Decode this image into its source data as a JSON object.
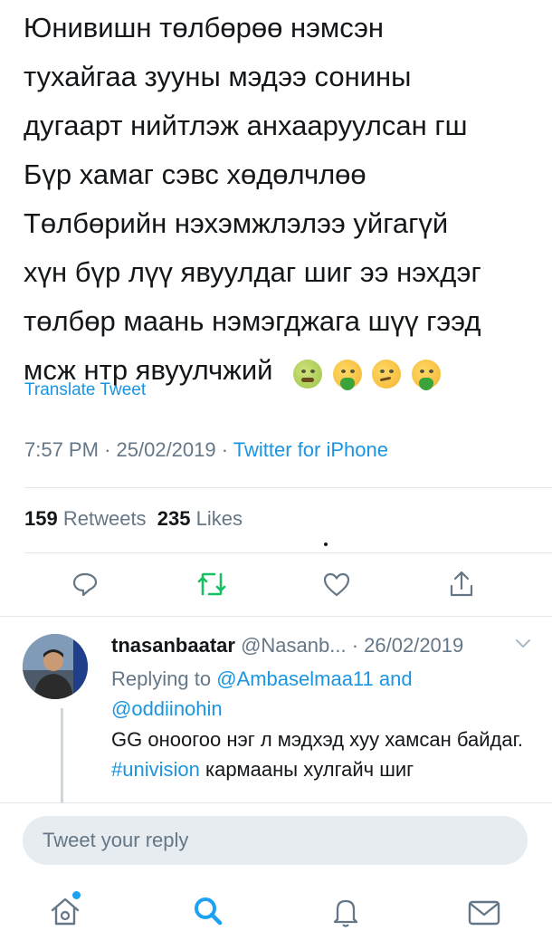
{
  "tweet": {
    "lines": [
      "Юнивишн төлбөрөө нэмсэн",
      "тухайгаа зууны мэдээ сонины",
      "дугаарт нийтлэж анхааруулсан гш",
      "Бүр хамаг сэвс хөдөлчлөө",
      "Төлбөрийн нэхэмжлэлээ уйгагүй",
      "хүн бүр лүү явуулдаг шиг ээ нэхдэг",
      "төлбөр маань нэмэгджага шүү гээд",
      "мсж нтр явуулчжий"
    ],
    "emojis": [
      "nauseated-face",
      "vomiting-face",
      "woozy-face",
      "vomiting-face"
    ],
    "translate_label": "Translate Tweet",
    "time": "7:57 PM",
    "date": "25/02/2019",
    "source": "Twitter for iPhone",
    "separator": "·"
  },
  "stats": {
    "retweets_count": "159",
    "retweets_label": "Retweets",
    "likes_count": "235",
    "likes_label": "Likes"
  },
  "actions": [
    "reply-icon",
    "retweet-icon",
    "like-icon",
    "share-icon"
  ],
  "reply": {
    "name": "tnasanbaatar",
    "handle": "@Nasanb...",
    "separator": "·",
    "date": "26/02/2019",
    "replying_prefix": "Replying to",
    "replying_to_1": "@Ambaselmaa11",
    "replying_and": "and",
    "replying_to_2": "@oddiinohin",
    "text_part1": "GG оноогоо нэг л мэдхэд хуу хамсан байдаг.",
    "hashtag": "#univision",
    "text_part2": "кармааны хулгайч шиг"
  },
  "composer": {
    "placeholder": "Tweet your reply"
  },
  "tabs": [
    "home-icon",
    "search-icon",
    "notifications-icon",
    "messages-icon"
  ],
  "colors": {
    "accent": "#1b95e0",
    "retweet_green": "#17bf63",
    "muted": "#657786",
    "text": "#14171a"
  }
}
